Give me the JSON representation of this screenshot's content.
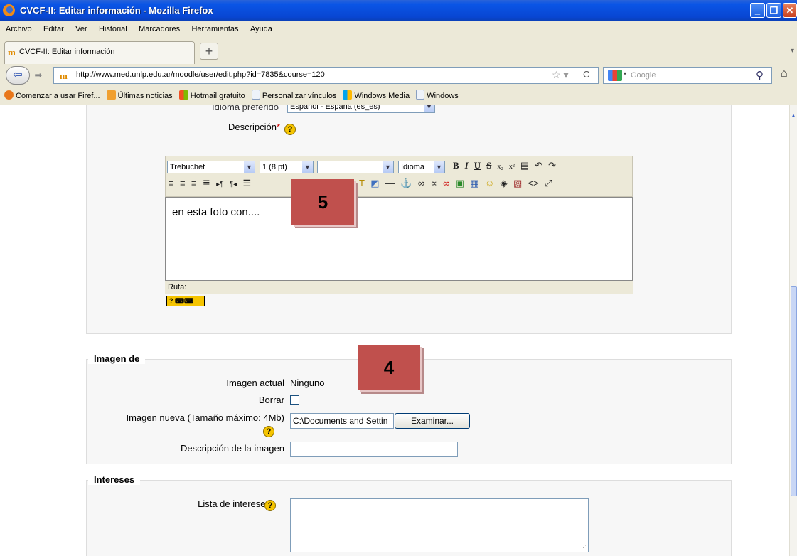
{
  "window": {
    "title": "CVCF-II: Editar información - Mozilla Firefox"
  },
  "menu": [
    "Archivo",
    "Editar",
    "Ver",
    "Historial",
    "Marcadores",
    "Herramientas",
    "Ayuda"
  ],
  "tab": {
    "label": "CVCF-II: Editar información",
    "new_tab": "+"
  },
  "nav": {
    "url": "http://www.med.unlp.edu.ar/moodle/user/edit.php?id=7835&course=120",
    "search_placeholder": "Google"
  },
  "bookmarks": [
    {
      "label": "Comenzar a usar Firef...",
      "color": "#e8771b"
    },
    {
      "label": "Últimas noticias",
      "color": "#f0a030"
    },
    {
      "label": "Hotmail gratuito",
      "color": "#2f8fd8"
    },
    {
      "label": "Personalizar vínculos",
      "color": "#d9e4f2"
    },
    {
      "label": "Windows Media",
      "color": "#2f8fd8"
    },
    {
      "label": "Windows",
      "color": "#d9e4f2"
    }
  ],
  "form": {
    "idioma_label": "Idioma preferido",
    "idioma_value": "Español - España (es_es)",
    "descripcion_label": "Descripción",
    "editor": {
      "font": "Trebuchet",
      "size": "1 (8 pt)",
      "style": "",
      "lang": "Idioma",
      "content": "en esta foto con....",
      "path_label": "Ruta:"
    },
    "imagen_legend": "Imagen de",
    "imagen_actual_label": "Imagen actual",
    "imagen_actual_value": "Ninguno",
    "borrar_label": "Borrar",
    "imagen_nueva_label": "Imagen nueva (Tamaño máximo: 4Mb)",
    "file_value": "C:\\Documents and Settin",
    "browse_label": "Examinar...",
    "desc_imagen_label": "Descripción de la imagen",
    "intereses_legend": "Intereses",
    "lista_intereses_label": "Lista de intereses"
  },
  "annotations": {
    "badge_5": "5",
    "badge_4": "4",
    "color": "#c0504d"
  }
}
